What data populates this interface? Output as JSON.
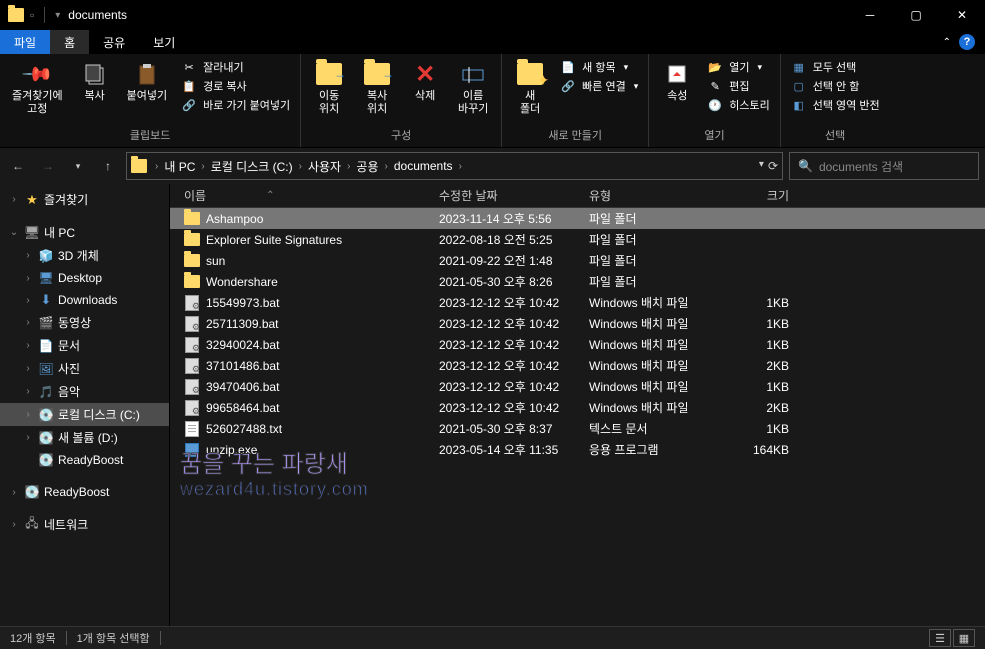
{
  "window": {
    "title": "documents"
  },
  "tabs": {
    "file": "파일",
    "home": "홈",
    "share": "공유",
    "view": "보기"
  },
  "ribbon": {
    "pin_favorites": "즐겨찾기에\n고정",
    "copy": "복사",
    "paste": "붙여넣기",
    "cut": "잘라내기",
    "copy_path": "경로 복사",
    "paste_shortcut": "바로 가기 붙여넣기",
    "clipboard_group": "클립보드",
    "move_to": "이동\n위치",
    "copy_to": "복사\n위치",
    "delete": "삭제",
    "rename": "이름\n바꾸기",
    "organize_group": "구성",
    "new_folder": "새\n폴더",
    "new_item": "새 항목",
    "easy_access": "빠른 연결",
    "new_group": "새로 만들기",
    "properties": "속성",
    "open": "열기",
    "edit": "편집",
    "history": "히스토리",
    "open_group": "열기",
    "select_all": "모두 선택",
    "select_none": "선택 안 함",
    "invert_selection": "선택 영역 반전",
    "select_group": "선택"
  },
  "breadcrumbs": [
    "내 PC",
    "로컬 디스크 (C:)",
    "사용자",
    "공용",
    "documents"
  ],
  "search_placeholder": "documents 검색",
  "tree": {
    "favorites": "즐겨찾기",
    "this_pc": "내 PC",
    "objects_3d": "3D 개체",
    "desktop": "Desktop",
    "downloads": "Downloads",
    "videos": "동영상",
    "documents_node": "문서",
    "pictures": "사진",
    "music": "음악",
    "local_disk": "로컬 디스크 (C:)",
    "new_volume": "새 볼륨 (D:)",
    "readyboost1": "ReadyBoost",
    "readyboost2": "ReadyBoost",
    "network": "네트워크"
  },
  "columns": {
    "name": "이름",
    "date": "수정한 날짜",
    "type": "유형",
    "size": "크기"
  },
  "files": [
    {
      "icon": "folder",
      "name": "Ashampoo",
      "date": "2023-11-14 오후 5:56",
      "type": "파일 폴더",
      "size": "",
      "selected": true
    },
    {
      "icon": "folder",
      "name": "Explorer Suite Signatures",
      "date": "2022-08-18 오전 5:25",
      "type": "파일 폴더",
      "size": ""
    },
    {
      "icon": "folder",
      "name": "sun",
      "date": "2021-09-22 오전 1:48",
      "type": "파일 폴더",
      "size": ""
    },
    {
      "icon": "folder",
      "name": "Wondershare",
      "date": "2021-05-30 오후 8:26",
      "type": "파일 폴더",
      "size": ""
    },
    {
      "icon": "bat",
      "name": "15549973.bat",
      "date": "2023-12-12 오후 10:42",
      "type": "Windows 배치 파일",
      "size": "1KB"
    },
    {
      "icon": "bat",
      "name": "25711309.bat",
      "date": "2023-12-12 오후 10:42",
      "type": "Windows 배치 파일",
      "size": "1KB"
    },
    {
      "icon": "bat",
      "name": "32940024.bat",
      "date": "2023-12-12 오후 10:42",
      "type": "Windows 배치 파일",
      "size": "1KB"
    },
    {
      "icon": "bat",
      "name": "37101486.bat",
      "date": "2023-12-12 오후 10:42",
      "type": "Windows 배치 파일",
      "size": "2KB"
    },
    {
      "icon": "bat",
      "name": "39470406.bat",
      "date": "2023-12-12 오후 10:42",
      "type": "Windows 배치 파일",
      "size": "1KB"
    },
    {
      "icon": "bat",
      "name": "99658464.bat",
      "date": "2023-12-12 오후 10:42",
      "type": "Windows 배치 파일",
      "size": "2KB"
    },
    {
      "icon": "txt",
      "name": "526027488.txt",
      "date": "2021-05-30 오후 8:37",
      "type": "텍스트 문서",
      "size": "1KB"
    },
    {
      "icon": "exe",
      "name": "unzip.exe",
      "date": "2023-05-14 오후 11:35",
      "type": "응용 프로그램",
      "size": "164KB"
    }
  ],
  "status": {
    "count": "12개 항목",
    "selected": "1개 항목 선택함"
  },
  "watermark": {
    "line1": "꿈을 꾸는 파랑새",
    "line2": "wezard4u.tistory.com"
  }
}
